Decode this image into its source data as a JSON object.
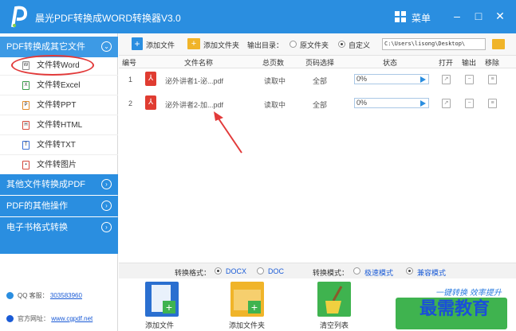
{
  "app": {
    "title": "晨光PDF转换成WORD转换器V3.0",
    "menu_label": "菜单",
    "logo_letter": "P"
  },
  "window_controls": {
    "minimize": "–",
    "maximize": "□",
    "close": "✕"
  },
  "sidebar": {
    "groups": [
      {
        "label": "PDF转换成其它文件",
        "expanded": true
      },
      {
        "label": "其他文件转换成PDF",
        "expanded": false
      },
      {
        "label": "PDF的其他操作",
        "expanded": false
      },
      {
        "label": "电子书格式转换",
        "expanded": false
      }
    ],
    "items": [
      {
        "label": "文件转Word",
        "icon": "word-doc-icon",
        "glyph": "W"
      },
      {
        "label": "文件转Excel",
        "icon": "excel-doc-icon",
        "glyph": "X"
      },
      {
        "label": "文件转PPT",
        "icon": "ppt-doc-icon",
        "glyph": "P"
      },
      {
        "label": "文件转HTML",
        "icon": "html-doc-icon",
        "glyph": "H"
      },
      {
        "label": "文件转TXT",
        "icon": "txt-doc-icon",
        "glyph": "T"
      },
      {
        "label": "文件转图片",
        "icon": "image-doc-icon",
        "glyph": "▪"
      }
    ],
    "contact": {
      "qq_label": "QQ 客服：",
      "qq": "303583960",
      "site_label": "官方网址：",
      "site": "www.cgpdf.net"
    }
  },
  "toolbar": {
    "add_file": "添加文件",
    "add_folder": "添加文件夹",
    "output_label": "输出目录：",
    "opt_original": "原文件夹",
    "opt_custom": "自定义",
    "output_path": "C:\\Users\\lisong\\Desktop\\"
  },
  "table": {
    "headers": {
      "index": "编号",
      "name": "文件名称",
      "pages": "总页数",
      "select": "页码选择",
      "status": "状态",
      "open": "打开",
      "output": "输出",
      "remove": "移除"
    },
    "rows": [
      {
        "index": "1",
        "name": "泌外讲者1-泌...pdf",
        "pages": "读取中",
        "select": "全部",
        "progress": "0%"
      },
      {
        "index": "2",
        "name": "泌外讲者2-加...pdf",
        "pages": "读取中",
        "select": "全部",
        "progress": "0%"
      }
    ]
  },
  "modes": {
    "format_label": "转换格式：",
    "docx": "DOCX",
    "doc": "DOC",
    "mode_label": "转换模式：",
    "fast": "极速模式",
    "compat": "兼容模式"
  },
  "bottom": {
    "add_file": "添加文件",
    "add_folder": "添加文件夹",
    "clear": "清空列表",
    "slogan": "一键转换 效率提升",
    "watermark": "最需教育"
  },
  "colors": {
    "accent": "#2a8ee0",
    "convert": "#3fb34f",
    "annotation": "#e23a3a"
  }
}
